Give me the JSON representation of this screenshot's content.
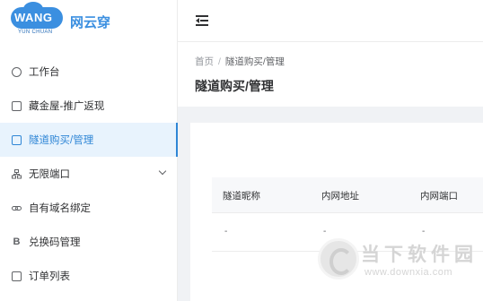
{
  "brand": {
    "logo_text": "WANG",
    "logo_sub": "YUN CHUAN",
    "name": "网云穿",
    "accent_color": "#3b8fe0"
  },
  "sidebar": {
    "items": [
      {
        "label": "工作台",
        "icon": "dashboard-icon"
      },
      {
        "label": "藏金屋-推广返现",
        "icon": "gift-icon"
      },
      {
        "label": "隧道购买/管理",
        "icon": "tunnel-icon",
        "active": true
      },
      {
        "label": "无限端口",
        "icon": "network-icon",
        "expandable": true
      },
      {
        "label": "自有域名绑定",
        "icon": "link-icon"
      },
      {
        "label": "兑换码管理",
        "icon": "bold-b-icon"
      },
      {
        "label": "订单列表",
        "icon": "order-icon"
      }
    ]
  },
  "header": {
    "collapse_icon": "menu-fold-icon"
  },
  "breadcrumb": {
    "home": "首页",
    "separator": "/",
    "current": "隧道购买/管理"
  },
  "page": {
    "title": "隧道购买/管理"
  },
  "table": {
    "columns": [
      "隧道昵称",
      "内网地址",
      "内网端口"
    ],
    "rows": [
      [
        "-",
        "-",
        "-"
      ]
    ]
  },
  "watermark": {
    "title": "当下软件园",
    "url": "www.downxia.com"
  }
}
